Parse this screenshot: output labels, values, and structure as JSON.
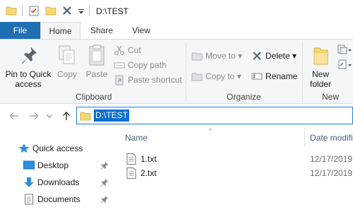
{
  "window": {
    "title": "D:\\TEST"
  },
  "ribbon_tabs": {
    "file": "File",
    "home": "Home",
    "share": "Share",
    "view": "View"
  },
  "ribbon": {
    "clipboard": {
      "pin_line1": "Pin to Quick",
      "pin_line2": "access",
      "copy": "Copy",
      "paste": "Paste",
      "cut": "Cut",
      "copy_path": "Copy path",
      "paste_shortcut": "Paste shortcut",
      "group_label": "Clipboard"
    },
    "organize": {
      "move_to": "Move to",
      "copy_to": "Copy to",
      "delete": "Delete",
      "rename": "Rename",
      "group_label": "Organize"
    },
    "new": {
      "new_folder_line1": "New",
      "new_folder_line2": "folder",
      "group_label": "New"
    }
  },
  "address": {
    "path": "D:\\TEST"
  },
  "nav": {
    "quick_access": "Quick access",
    "items": [
      {
        "label": "Desktop"
      },
      {
        "label": "Downloads"
      },
      {
        "label": "Documents"
      }
    ]
  },
  "file_list": {
    "columns": {
      "name": "Name",
      "date": "Date modifi"
    },
    "rows": [
      {
        "name": "1.txt",
        "date": "12/17/2019"
      },
      {
        "name": "2.txt",
        "date": "12/17/2019"
      }
    ]
  },
  "colors": {
    "file_tab": "#1f6fb3",
    "selection": "#0a6fd1",
    "folder": "#f8d775",
    "ribbon_bg": "#f5f6f7"
  }
}
